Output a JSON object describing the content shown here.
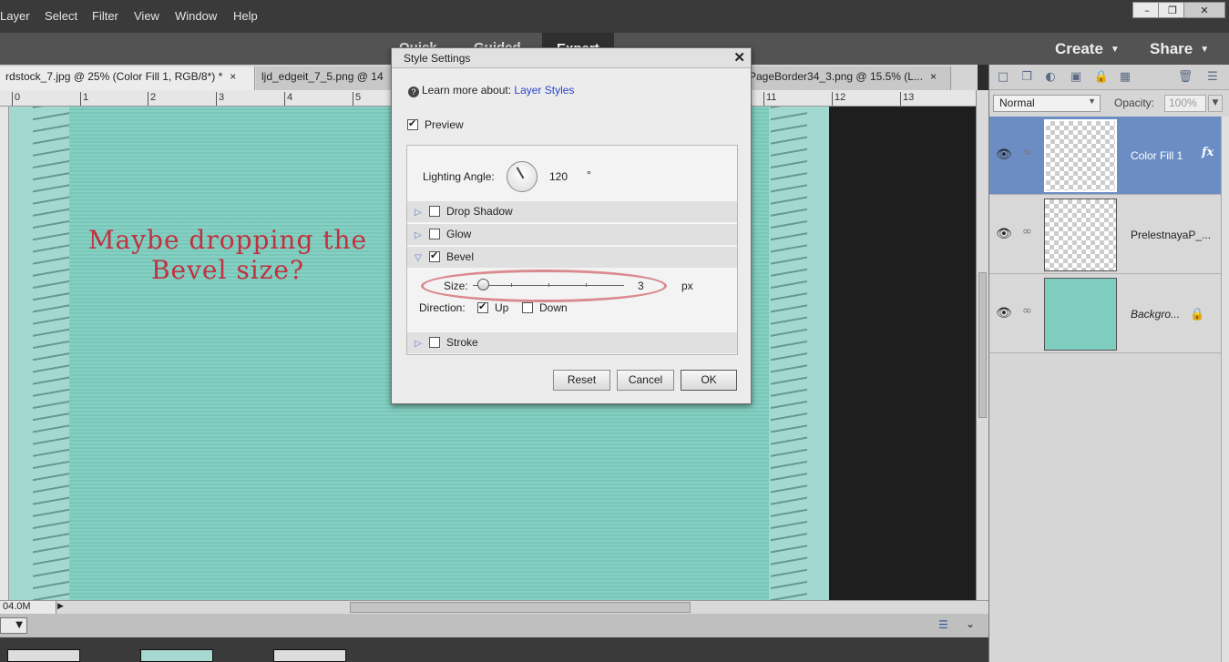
{
  "menu": [
    "Layer",
    "Select",
    "Filter",
    "View",
    "Window",
    "Help"
  ],
  "window_controls": {
    "minimize": "–",
    "restore": "❐",
    "close": "✕"
  },
  "modes": [
    "Quick",
    "Guided",
    "Expert"
  ],
  "header": {
    "create": "Create",
    "share": "Share"
  },
  "tabs": [
    {
      "label": "rdstock_7.jpg @ 25% (Color Fill 1, RGB/8*) *",
      "close": "×"
    },
    {
      "label": "ljd_edgeit_7_5.png @ 14",
      "close": ""
    },
    {
      "label": "PageBorder34_3.png @ 15.5% (L...",
      "close": "×"
    }
  ],
  "ruler": [
    "0",
    "1",
    "2",
    "3",
    "4",
    "5",
    "11",
    "12",
    "13"
  ],
  "canvas": {
    "line1": "Maybe dropping the",
    "line2": "Bevel size?",
    "bg_color": "#7ecdbf",
    "text_color": "#c0313f"
  },
  "status": {
    "file_size": "04.0M"
  },
  "layers_panel": {
    "blend_mode": "Normal",
    "opacity_label": "Opacity:",
    "opacity_value": "100%",
    "layers": [
      {
        "name": "Color Fill 1",
        "badge": "fx",
        "selected": true
      },
      {
        "name": "PrelestnayaP_...",
        "selected": false
      },
      {
        "name": "Backgro...",
        "selected": false
      }
    ]
  },
  "dialog": {
    "title": "Style Settings",
    "close": "✕",
    "learn_more_prefix": "Learn more about:",
    "learn_more_link": "Layer Styles",
    "preview_label": "Preview",
    "preview_checked": true,
    "lighting_angle_label": "Lighting Angle:",
    "lighting_angle_value": "120",
    "lighting_angle_unit": "°",
    "effects": [
      {
        "name": "Drop Shadow",
        "checked": false,
        "expanded": false
      },
      {
        "name": "Glow",
        "checked": false,
        "expanded": false
      },
      {
        "name": "Bevel",
        "checked": true,
        "expanded": true
      },
      {
        "name": "Stroke",
        "checked": false,
        "expanded": false
      }
    ],
    "bevel": {
      "size_label": "Size:",
      "size_value": "3",
      "size_unit": "px",
      "direction_label": "Direction:",
      "up_label": "Up",
      "up_checked": true,
      "down_label": "Down",
      "down_checked": false
    },
    "buttons": {
      "reset": "Reset",
      "cancel": "Cancel",
      "ok": "OK"
    },
    "highlight_color": "#d98a8f"
  }
}
